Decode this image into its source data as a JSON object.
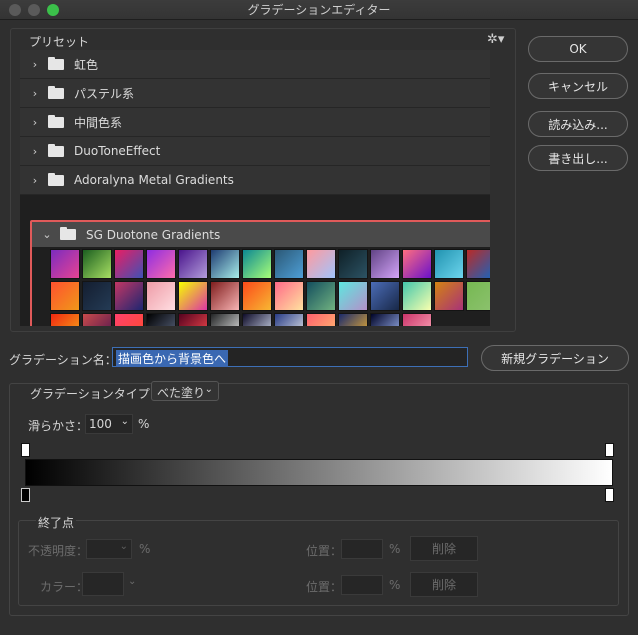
{
  "window": {
    "title": "グラデーションエディター"
  },
  "presets": {
    "title": "プリセット",
    "folders": [
      {
        "label": "虹色",
        "expanded": false
      },
      {
        "label": "パステル系",
        "expanded": false
      },
      {
        "label": "中間色系",
        "expanded": false
      },
      {
        "label": "DuoToneEffect",
        "expanded": false
      },
      {
        "label": "Adoralyna Metal Gradients",
        "expanded": false
      },
      {
        "label": "SG Duotone Gradients",
        "expanded": true
      }
    ],
    "swatches": [
      [
        "#7b2cbf",
        "#e84393"
      ],
      [
        "#1b5e20",
        "#a8e063"
      ],
      [
        "#e91e63",
        "#3f51b5"
      ],
      [
        "#8e2de2",
        "#ff6cab"
      ],
      [
        "#4a148c",
        "#b39ddb"
      ],
      [
        "#1e3c72",
        "#a8edea"
      ],
      [
        "#0b8793",
        "#a8ff78"
      ],
      [
        "#2b5876",
        "#4e9fd6"
      ],
      [
        "#ff9a9e",
        "#a1c4fd"
      ],
      [
        "#0f2027",
        "#2c5364"
      ],
      [
        "#614385",
        "#d4a5f9"
      ],
      [
        "#ff6e7f",
        "#6a11cb"
      ],
      [
        "#2193b0",
        "#6dd5ed"
      ],
      [
        "#b92b27",
        "#1565c0"
      ],
      [
        "#3a1c71",
        "#ffd86f"
      ],
      [
        "#ff512f",
        "#f09819"
      ],
      [
        "#141e30",
        "#243b55"
      ],
      [
        "#c33764",
        "#1d2671"
      ],
      [
        "#ee9ca7",
        "#ffdde1"
      ],
      [
        "#f7ff00",
        "#db36a4"
      ],
      [
        "#7f1d1d",
        "#f8b4b4"
      ],
      [
        "#fc4a1a",
        "#f7b733"
      ],
      [
        "#ff6a88",
        "#ffe29f"
      ],
      [
        "#134e5e",
        "#71b280"
      ],
      [
        "#5ee7df",
        "#b490ca"
      ],
      [
        "#4b6cb7",
        "#182848"
      ],
      [
        "#43c6ac",
        "#f8ffae"
      ],
      [
        "#d38312",
        "#a83279"
      ],
      [
        "#76b852",
        "#8dc26f"
      ],
      [
        "#ff0099",
        "#493240"
      ],
      [
        "#f12711",
        "#f5af19"
      ],
      [
        "#c94b4b",
        "#4b134f"
      ],
      [
        "#ff416c",
        "#ff4b2b"
      ],
      [
        "#000000",
        "#606c88"
      ],
      [
        "#56021f",
        "#ff4e50"
      ],
      [
        "#232526",
        "#f3f3f3"
      ],
      [
        "#0f0c29",
        "#e0eafc"
      ],
      [
        "#283c86",
        "#f0f2f0"
      ],
      [
        "#ff5f6d",
        "#ffc371"
      ],
      [
        "#1a2a6c",
        "#fdbb2d"
      ],
      [
        "#000428",
        "#a8c0ff"
      ],
      [
        "#cb356b",
        "#ffafbd"
      ]
    ]
  },
  "buttons": {
    "ok": "OK",
    "cancel": "キャンセル",
    "load": "読み込み...",
    "save": "書き出し...",
    "new_gradient": "新規グラデーション"
  },
  "name": {
    "label": "グラデーション名：",
    "value": "描画色から背景色へ"
  },
  "type": {
    "label": "グラデーションタイプ：",
    "value": "べた塗り"
  },
  "smooth": {
    "label": "滑らかさ：",
    "value": "100",
    "unit": "%"
  },
  "stops": {
    "title": "終了点",
    "opacity_label": "不透明度：",
    "opacity_unit": "%",
    "location_label": "位置：",
    "location_unit": "%",
    "delete_label": "削除",
    "color_label": "カラー：",
    "location2_label": "位置：",
    "location2_unit": "%",
    "delete2_label": "削除"
  },
  "colors": {
    "selection_border": "#e05a5a",
    "gradient_start": "#000000",
    "gradient_end": "#ffffff"
  }
}
